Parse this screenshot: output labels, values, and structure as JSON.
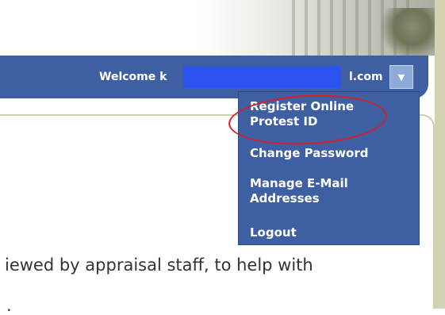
{
  "header": {
    "welcome_prefix": "Welcome k",
    "email_suffix": "l.com",
    "dropdown_icon": "caret-down-icon"
  },
  "user_menu": {
    "items": [
      {
        "label": "Register Online Protest ID",
        "highlighted": true
      },
      {
        "label": "Change Password"
      },
      {
        "label": "Manage E-Mail Addresses"
      },
      {
        "label": "Logout"
      }
    ]
  },
  "content": {
    "line1": "iewed by appraisal staff, to help with",
    "line2": "."
  },
  "colors": {
    "navbar": "#3f5fa3",
    "menu": "#3f5fa3",
    "redaction": "#2a53f0",
    "highlight": "#d3202a",
    "side_bar": "#d3d3b4"
  }
}
